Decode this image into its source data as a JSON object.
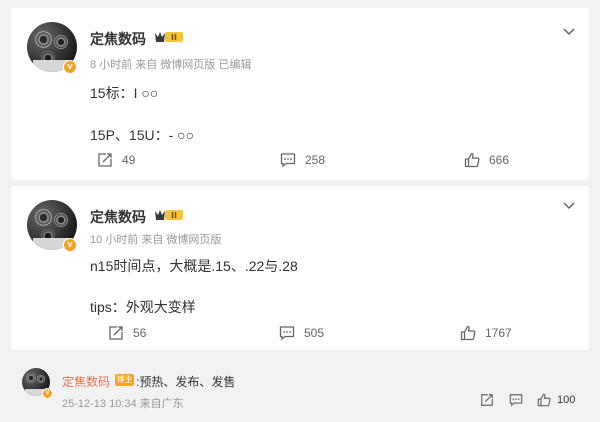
{
  "posts": [
    {
      "author": "定焦数码",
      "meta": "8 小时前  来自 微博网页版 已编辑",
      "lines": [
        "15标：I ○○",
        "15P、15U：- ○○"
      ],
      "actions": {
        "repost": "49",
        "comment": "258",
        "like": "666"
      }
    },
    {
      "author": "定焦数码",
      "meta": "10 小时前  来自 微博网页版",
      "lines": [
        "n15时间点，大概是.15、.22与.28",
        "tips：外观大变样"
      ],
      "actions": {
        "repost": "56",
        "comment": "505",
        "like": "1767"
      }
    }
  ],
  "badges": {
    "verified": "v",
    "level": "II",
    "blogger": "博主"
  },
  "comment": {
    "author": "定焦数码",
    "text": "预热、发布、发售",
    "separator": ":",
    "meta": "25-12-13 10:34  来自广东",
    "likes": "100"
  },
  "icons": [
    "repost-icon",
    "comment-icon",
    "like-icon",
    "chevron-down-icon",
    "verified-badge-icon",
    "crown-badge-icon"
  ],
  "colors": {
    "accent": "#eb7350",
    "badge": "#f6a321",
    "muted": "#999999"
  }
}
